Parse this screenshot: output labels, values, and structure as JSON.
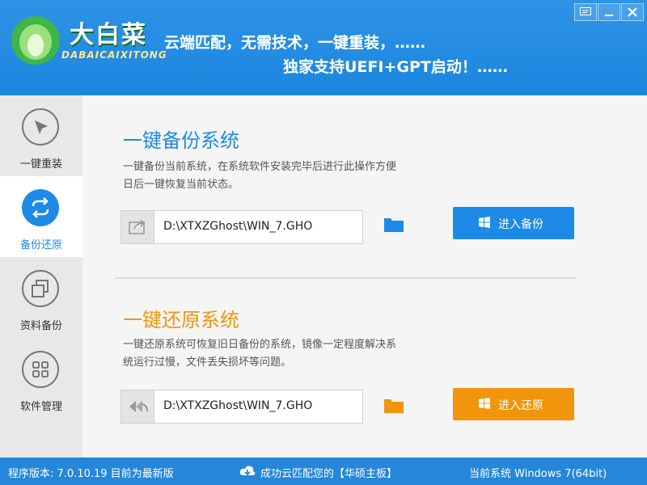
{
  "header": {
    "logo_text": "大白菜",
    "logo_sub": "DABAICAIXITONG",
    "slogan_line1": "云端匹配，无需技术，一键重装，……",
    "slogan_line2": "独家支持UEFI+GPT启动！……",
    "window_buttons": [
      "menu-icon",
      "minimize-icon",
      "close-icon"
    ]
  },
  "sidebar": {
    "items": [
      {
        "label": "一键重装",
        "icon": "cursor-arrow-icon"
      },
      {
        "label": "备份还原",
        "icon": "sync-arrows-icon",
        "active": true
      },
      {
        "label": "资料备份",
        "icon": "copy-squares-icon"
      },
      {
        "label": "软件管理",
        "icon": "grid-apps-icon"
      }
    ]
  },
  "backup": {
    "title": "一键备份系统",
    "description": "一键备份当前系统，在系统软件安装完毕后进行此操作方便日后一键恢复当前状态。",
    "path": "D:\\XTXZGhost\\WIN_7.GHO",
    "button_label": "进入备份",
    "accent": "#1c8ae6"
  },
  "restore": {
    "title": "一键还原系统",
    "description": "一键还原系统可恢复旧日备份的系统，镜像一定程度解决系统运行过慢，文件丢失损坏等问题。",
    "path": "D:\\XTXZGhost\\WIN_7.GHO",
    "button_label": "进入还原",
    "accent": "#f0950c"
  },
  "status_bar": {
    "version": "程序版本: 7.0.10.19 目前为最新版",
    "match": "成功云匹配您的【华硕主板】",
    "current_system": "当前系统 Windows 7(64bit)"
  }
}
